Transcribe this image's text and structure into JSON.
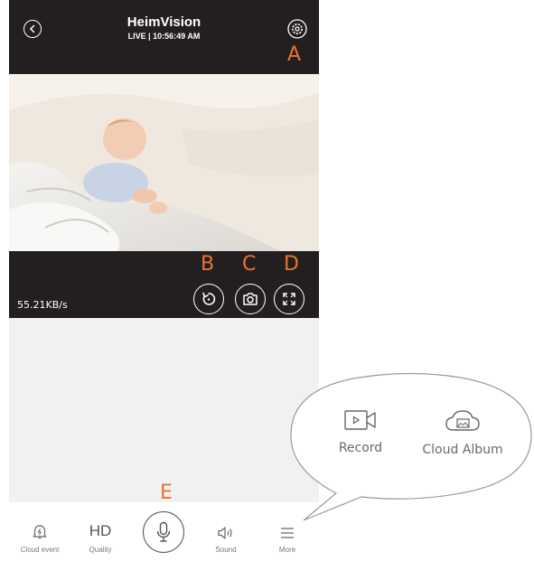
{
  "header": {
    "title": "HeimVision",
    "status": "LIVE | 10:56:49 AM"
  },
  "callouts": {
    "a": "A",
    "b": "B",
    "c": "C",
    "d": "D",
    "e": "E"
  },
  "stream": {
    "speed": "55.21KB/s"
  },
  "bottom_nav": {
    "cloud_event": "Cloud event",
    "quality_value": "HD",
    "quality": "Quality",
    "sound": "Sound",
    "more": "More"
  },
  "more_popup": {
    "record": "Record",
    "cloud_album": "Cloud Album"
  },
  "icons": [
    "back-icon",
    "gear-icon",
    "replay-icon",
    "camera-icon",
    "fullscreen-icon",
    "cloud-event-icon",
    "microphone-icon",
    "speaker-icon",
    "menu-icon",
    "video-camera-icon",
    "cloud-image-icon"
  ]
}
